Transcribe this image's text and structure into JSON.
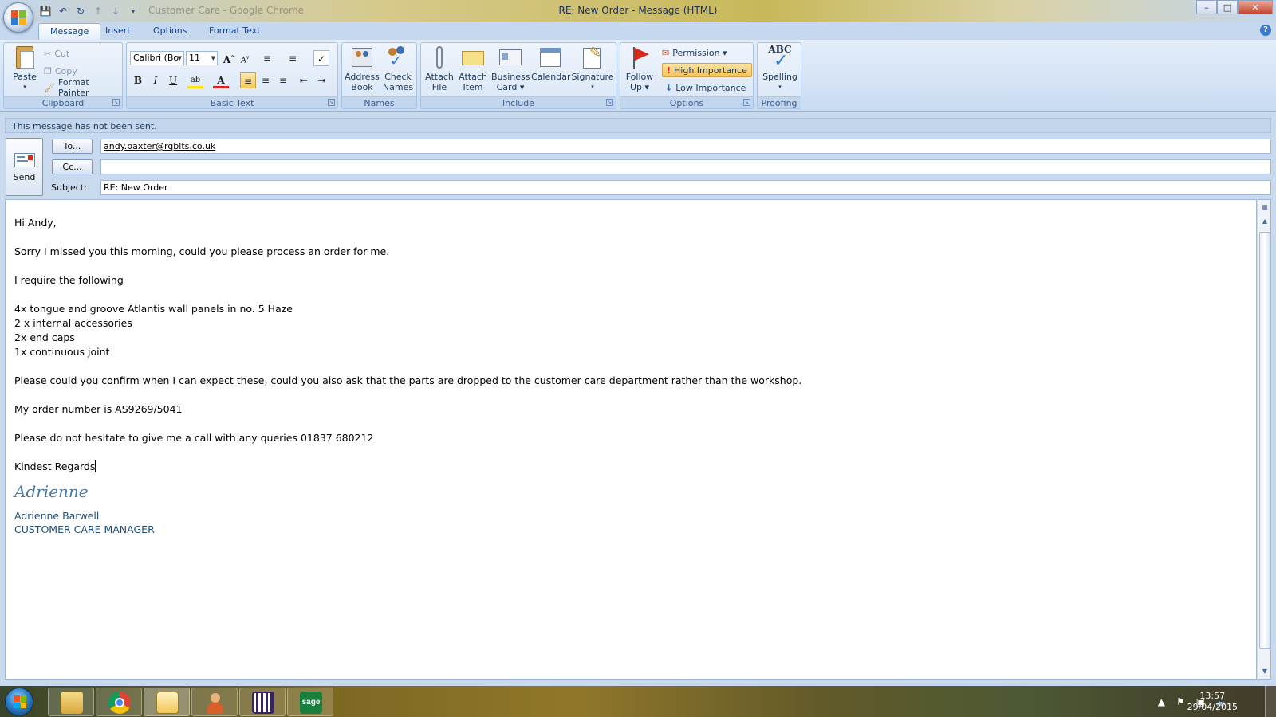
{
  "window": {
    "title": "RE: New Order  -  Message (HTML)",
    "ghost_text": "Customer Care - Google Chrome",
    "min": "–",
    "max": "□",
    "close": "✕"
  },
  "tabs": [
    "Message",
    "Insert",
    "Options",
    "Format Text"
  ],
  "help": "?",
  "ribbon": {
    "clipboard": {
      "label": "Clipboard",
      "paste": "Paste",
      "cut": "Cut",
      "copy": "Copy",
      "format_painter": "Format Painter"
    },
    "basic_text": {
      "label": "Basic Text",
      "font": "Calibri (Bo",
      "size": "11",
      "bold": "B",
      "italic": "I",
      "underline": "U"
    },
    "names": {
      "label": "Names",
      "address_book": [
        "Address",
        "Book"
      ],
      "check_names": [
        "Check",
        "Names"
      ]
    },
    "include": {
      "label": "Include",
      "attach_file": [
        "Attach",
        "File"
      ],
      "attach_item": [
        "Attach",
        "Item"
      ],
      "business_card": [
        "Business",
        "Card ▾"
      ],
      "calendar": "Calendar",
      "signature": [
        "Signature",
        "▾"
      ]
    },
    "options": {
      "label": "Options",
      "follow_up": [
        "Follow",
        "Up ▾"
      ],
      "permission": "Permission ▾",
      "high_importance": "High Importance",
      "low_importance": "Low Importance"
    },
    "proofing": {
      "label": "Proofing",
      "spelling": [
        "Spelling",
        "▾"
      ],
      "abc": "ABC"
    }
  },
  "message": {
    "info": "This message has not been sent.",
    "send": "Send",
    "to_btn": "To...",
    "cc_btn": "Cc...",
    "subject_label": "Subject:",
    "to_value": "andy.baxter@rqblts.co.uk",
    "cc_value": "",
    "subject_value": "RE: New Order"
  },
  "body": {
    "greeting": "Hi Andy,",
    "p1": "Sorry I missed you this morning, could you please process an order for me.",
    "p2": "I require the following",
    "items": [
      "4x tongue and groove Atlantis wall panels in no. 5 Haze",
      "2 x internal accessories",
      "2x end caps",
      "1x continuous joint"
    ],
    "p3": "Please could you confirm when I can expect these, could you also ask that the parts are dropped to the customer care department rather than the workshop.",
    "p4": "My order number is AS9269/5041",
    "p5": "Please do not hesitate to give me a call with any queries 01837 680212",
    "closing": "Kindest Regards",
    "signature_script": "Adrienne",
    "signature_name": "Adrienne Barwell",
    "signature_title": "CUSTOMER CARE MANAGER"
  },
  "taskbar": {
    "time": "13:57",
    "date": "29/04/2015",
    "sage": "sage"
  }
}
